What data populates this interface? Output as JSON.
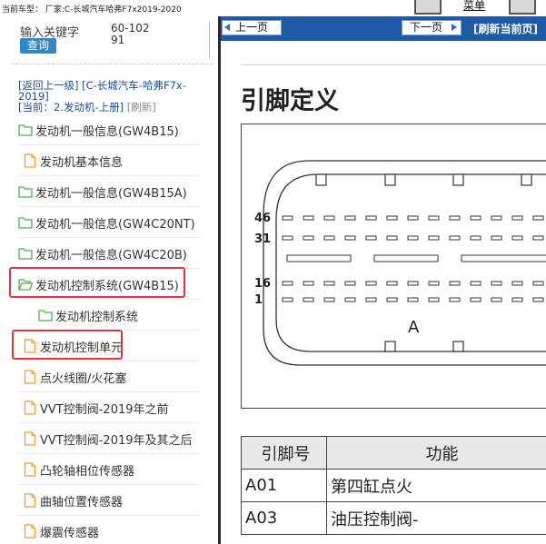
{
  "top_bar": {
    "current_vehicle": "当前车型：  厂家:C-长城汽车哈弗F7x2019-2020",
    "menu_label": "菜单"
  },
  "search": {
    "keyword_label": "输入关键字",
    "query_button": "查询",
    "code": "60-10291"
  },
  "breadcrumb": {
    "back_up": "[返回上一级]",
    "vehicle": "[C-长城汽车-哈弗F7x-2019]",
    "current": "[当前：2.发动机-上册]",
    "refresh": "[刷新]"
  },
  "tree": [
    {
      "label": "发动机一般信息(GW4B15)",
      "icon": "folder-icon",
      "level": 0
    },
    {
      "label": "发动机基本信息",
      "icon": "document-icon",
      "level": 1
    },
    {
      "label": "发动机一般信息(GW4B15A)",
      "icon": "folder-icon",
      "level": 0
    },
    {
      "label": "发动机一般信息(GW4C20NT)",
      "icon": "folder-icon",
      "level": 0
    },
    {
      "label": "发动机一般信息(GW4C20B)",
      "icon": "folder-icon",
      "level": 0
    },
    {
      "label": "发动机控制系统(GW4B15)",
      "icon": "folder-open-icon",
      "level": 0,
      "highlighted": true
    },
    {
      "label": "发动机控制系统",
      "icon": "folder-icon",
      "level": 2
    },
    {
      "label": "发动机控制单元",
      "icon": "document-icon",
      "level": 1,
      "highlighted": true
    },
    {
      "label": "点火线圈/火花塞",
      "icon": "document-icon",
      "level": 1
    },
    {
      "label": "VVT控制阀-2019年之前",
      "icon": "document-icon",
      "level": 1
    },
    {
      "label": "VVT控制阀-2019年及其之后",
      "icon": "document-icon",
      "level": 1
    },
    {
      "label": "凸轮轴相位传感器",
      "icon": "document-icon",
      "level": 1
    },
    {
      "label": "曲轴位置传感器",
      "icon": "document-icon",
      "level": 1
    },
    {
      "label": "爆震传感器",
      "icon": "document-icon",
      "level": 1
    }
  ],
  "nav": {
    "prev": "上一页",
    "next": "下一页",
    "refresh_page": "[刷新当前页]"
  },
  "document": {
    "title": "引脚定义",
    "connector": {
      "row_labels": [
        "46",
        "31",
        "16",
        "1"
      ],
      "connector_id": "A"
    },
    "table": {
      "headers": [
        "引脚号",
        "功能"
      ],
      "rows": [
        {
          "pin": "A01",
          "function": "第四缸点火"
        },
        {
          "pin": "A03",
          "function": "油压控制阀-"
        }
      ]
    }
  },
  "colors": {
    "nav_blue": "#1e5aa8",
    "highlight_red": "#e0363a",
    "folder_green": "#4caf50",
    "document_orange": "#f0a030",
    "link_blue": "#1a4fa0"
  }
}
